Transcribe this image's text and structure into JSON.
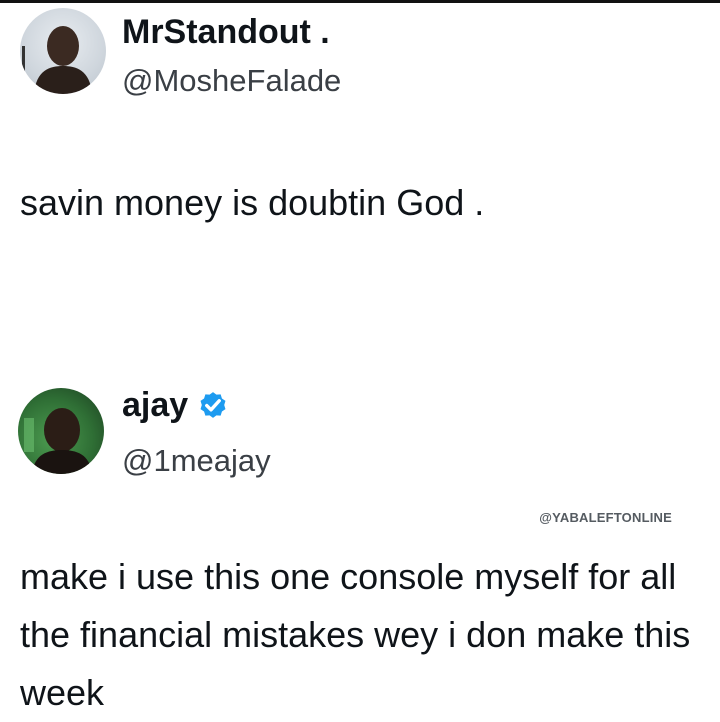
{
  "tweets": [
    {
      "display_name": "MrStandout .",
      "handle": "@MosheFalade",
      "verified": false,
      "text": "savin money is doubtin God ."
    },
    {
      "display_name": "ajay",
      "handle": "@1meajay",
      "verified": true,
      "text": "make i use this one console myself for all the financial mistakes wey i don make this week"
    }
  ],
  "watermark": "@YABALEFTONLINE",
  "colors": {
    "verified_badge": "#1d9bf0",
    "text": "#0f1419",
    "handle": "#3a3f45"
  }
}
